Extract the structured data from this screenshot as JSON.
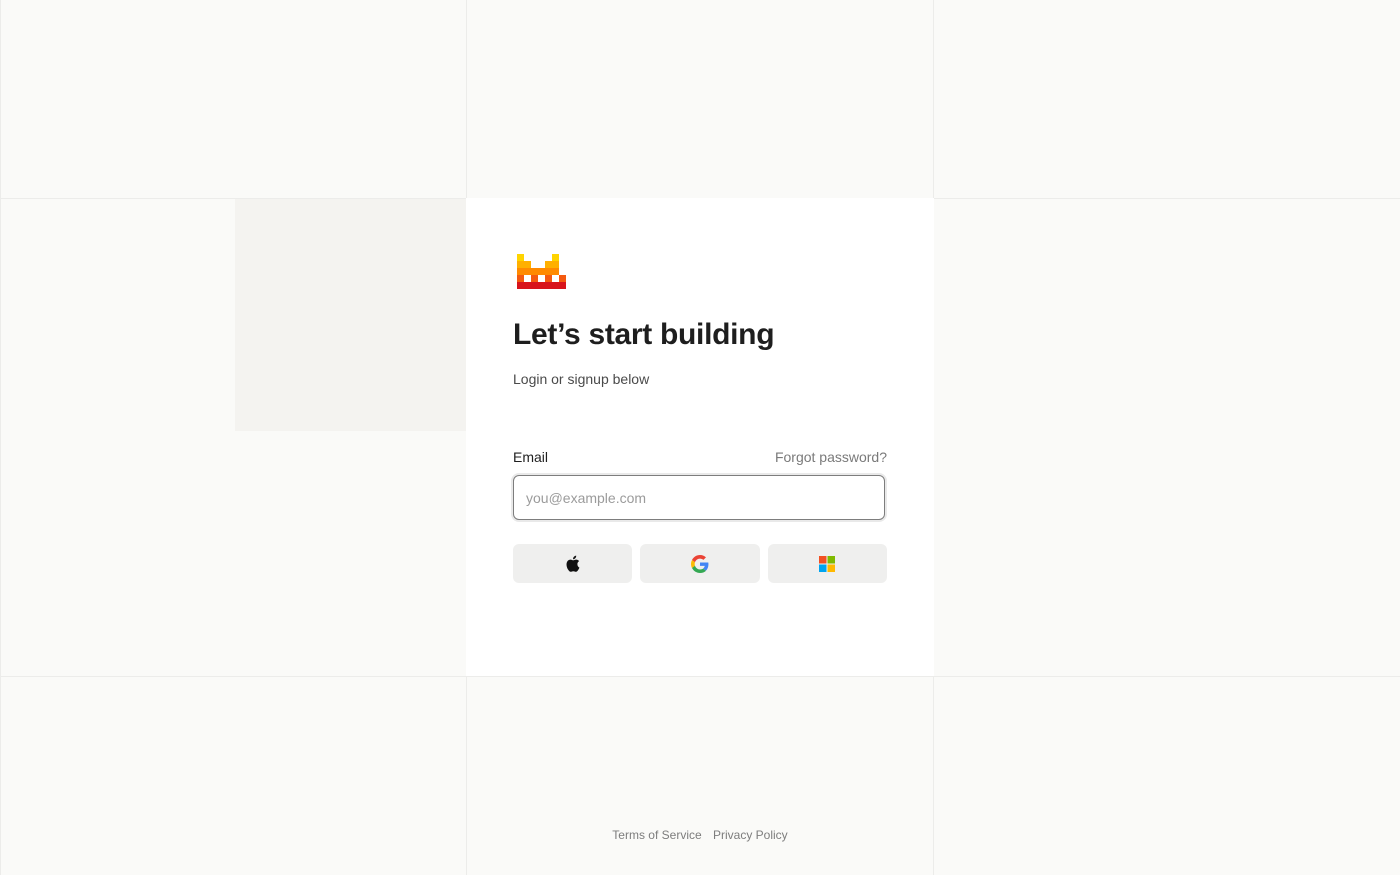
{
  "auth": {
    "logo_icon": "brand-logo-icon",
    "title": "Let’s start building",
    "subtitle": "Login or signup below",
    "email_label": "Email",
    "forgot_password": "Forgot password?",
    "email_placeholder": "you@example.com",
    "email_value": ""
  },
  "sso": {
    "apple_icon": "apple-icon",
    "google_icon": "google-icon",
    "microsoft_icon": "microsoft-icon"
  },
  "footer": {
    "terms": "Terms of Service",
    "privacy": "Privacy Policy"
  },
  "colors": {
    "background": "#fafaf8",
    "card": "#ffffff",
    "logo_yellow": "#ffd400",
    "logo_orange": "#ff8a00",
    "logo_dark_orange": "#f45a10",
    "logo_red": "#d8141b"
  }
}
